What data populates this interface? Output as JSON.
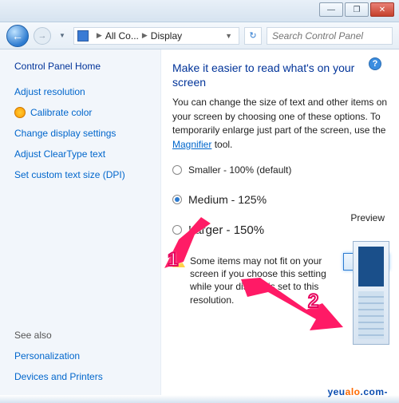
{
  "titlebar": {
    "min": "—",
    "max": "❐",
    "close": "✕"
  },
  "nav": {
    "bc1": "All Co...",
    "bc2": "Display",
    "search_placeholder": "Search Control Panel"
  },
  "sidebar": {
    "home": "Control Panel Home",
    "items": [
      {
        "label": "Adjust resolution"
      },
      {
        "label": "Calibrate color"
      },
      {
        "label": "Change display settings"
      },
      {
        "label": "Adjust ClearType text"
      },
      {
        "label": "Set custom text size (DPI)"
      }
    ],
    "seealso_title": "See also",
    "seealso": [
      {
        "label": "Personalization"
      },
      {
        "label": "Devices and Printers"
      }
    ]
  },
  "main": {
    "title": "Make it easier to read what's on your screen",
    "desc_pre": "You can change the size of text and other items on your screen by choosing one of these options. To temporarily enlarge just part of the screen, use the ",
    "magnifier": "Magnifier",
    "desc_post": " tool.",
    "preview_label": "Preview",
    "options": {
      "smaller": "Smaller - 100% (default)",
      "medium": "Medium - 125%",
      "larger": "Larger - 150%"
    },
    "warning": "Some items may not fit on your screen if you choose this setting while your display is set to this resolution.",
    "apply": "Apply"
  },
  "annot": {
    "one": "1",
    "two": "2"
  },
  "watermark": {
    "a": "yeu",
    "b": "alo",
    "c": ".com-"
  }
}
